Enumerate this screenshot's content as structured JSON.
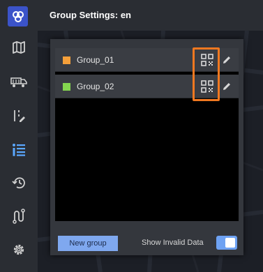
{
  "header": {
    "title": "Group Settings: en"
  },
  "rail": {
    "logo_icon": "logo-icon",
    "items": [
      {
        "name": "map-icon"
      },
      {
        "name": "vehicle-icon"
      },
      {
        "name": "route-edit-icon"
      },
      {
        "name": "group-list-icon",
        "active": true
      },
      {
        "name": "history-icon"
      },
      {
        "name": "path-icon"
      },
      {
        "name": "settings-gear-icon"
      }
    ]
  },
  "groups": [
    {
      "label": "Group_01",
      "color": "#f5a03a"
    },
    {
      "label": "Group_02",
      "color": "#84d64f"
    }
  ],
  "footer": {
    "new_group_label": "New group",
    "show_invalid_label": "Show Invalid Data",
    "show_invalid_on": true
  },
  "colors": {
    "accent": "#6ea2f3",
    "highlight": "#f07820",
    "rail_active": "#5aa7ff"
  }
}
